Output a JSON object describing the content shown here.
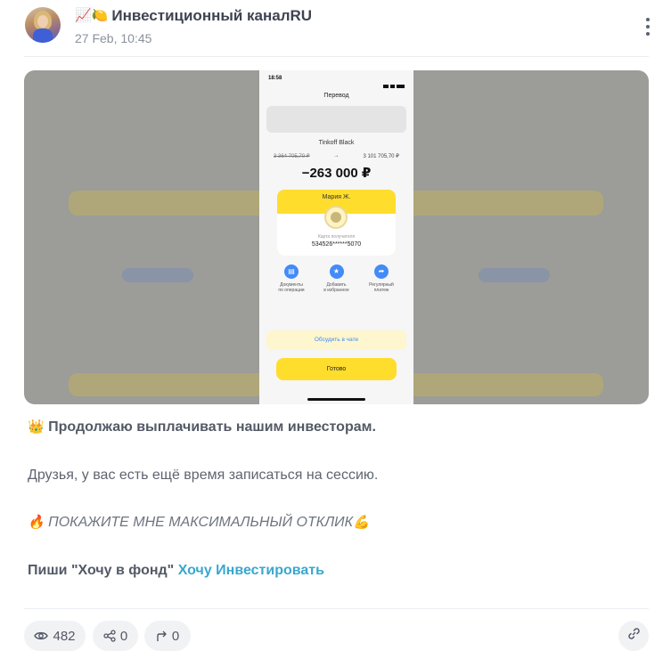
{
  "channel": {
    "title_emoji": "📈🍋",
    "name": "Инвестиционный каналRU",
    "date": "27 Feb, 10:45"
  },
  "screenshot": {
    "time": "18:58",
    "title": "Перевод",
    "card_name": "Tinkoff Black",
    "balance_before": "3 364 705,70 ₽",
    "arrow": "→",
    "balance_after": "3 101 705,70 ₽",
    "amount": "−263 000 ₽",
    "recipient": "Мария Ж.",
    "card_label": "Карта получателя",
    "card_number": "534526******5070",
    "actions": [
      {
        "icon": "document-icon",
        "glyph": "▤",
        "label1": "Документы",
        "label2": "по операции"
      },
      {
        "icon": "star-icon",
        "glyph": "★",
        "label1": "Добавить",
        "label2": "в избранное"
      },
      {
        "icon": "repeat-icon",
        "glyph": "➦",
        "label1": "Регулярный",
        "label2": "платеж"
      }
    ],
    "chat_button": "Обсудить в чате",
    "done_button": "Готово",
    "colors": {
      "yellow": "#ffdd2d",
      "blue": "#428bf9"
    }
  },
  "post": {
    "line1_emoji": "👑",
    "line1": "Продолжаю выплачивать нашим инвесторам.",
    "line2": "Друзья, у вас есть ещё время записаться на сессию.",
    "line3_emoji": "🔥",
    "line3": "ПОКАЖИТЕ МНЕ МАКСИМАЛЬНЫЙ ОТКЛИК",
    "line3_end_emoji": "💪",
    "line4_prefix": "Пиши \"Хочу в фонд\" ",
    "line4_link": "Хочу Инвестировать"
  },
  "footer": {
    "views": "482",
    "shares": "0",
    "forwards": "0"
  },
  "colors": {
    "link": "#3aa7cf",
    "pill_bg": "#f1f2f4"
  }
}
